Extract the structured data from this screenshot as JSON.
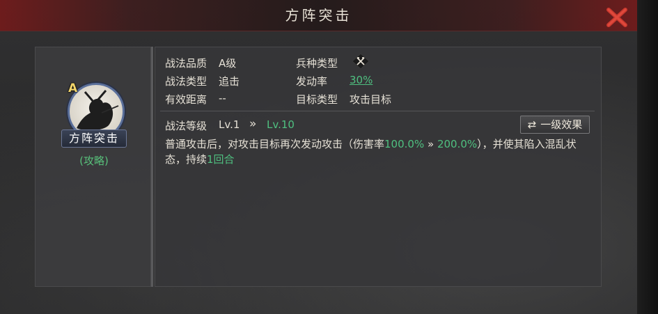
{
  "window": {
    "title": "方阵突击"
  },
  "skill": {
    "grade": "A",
    "name": "方阵突击",
    "guide_link": "(攻略)"
  },
  "attributes": {
    "quality_label": "战法品质",
    "quality_value": "A级",
    "troop_label": "兵种类型",
    "type_label": "战法类型",
    "type_value": "追击",
    "rate_label": "发动率",
    "rate_value": "30%",
    "range_label": "有效距离",
    "range_value": "--",
    "target_label": "目标类型",
    "target_value": "攻击目标"
  },
  "level": {
    "label": "战法等级",
    "from": "Lv.1",
    "arrow": "»",
    "to": "Lv.10",
    "effect_button": "一级效果"
  },
  "description": {
    "part1": "普通攻击后，对攻击目标再次发动攻击（伤害率",
    "rate_from": "100.0%",
    "arrow": " » ",
    "rate_to": "200.0%",
    "part2": "），并使其陷入混乱状态，持续",
    "duration": "1回合"
  },
  "colors": {
    "accent_green": "#4fc080",
    "title_red": "#8a1f1f",
    "grade_gold": "#f1d46a"
  },
  "icons": [
    "close-icon",
    "troop-type-icon",
    "swap-icon"
  ]
}
